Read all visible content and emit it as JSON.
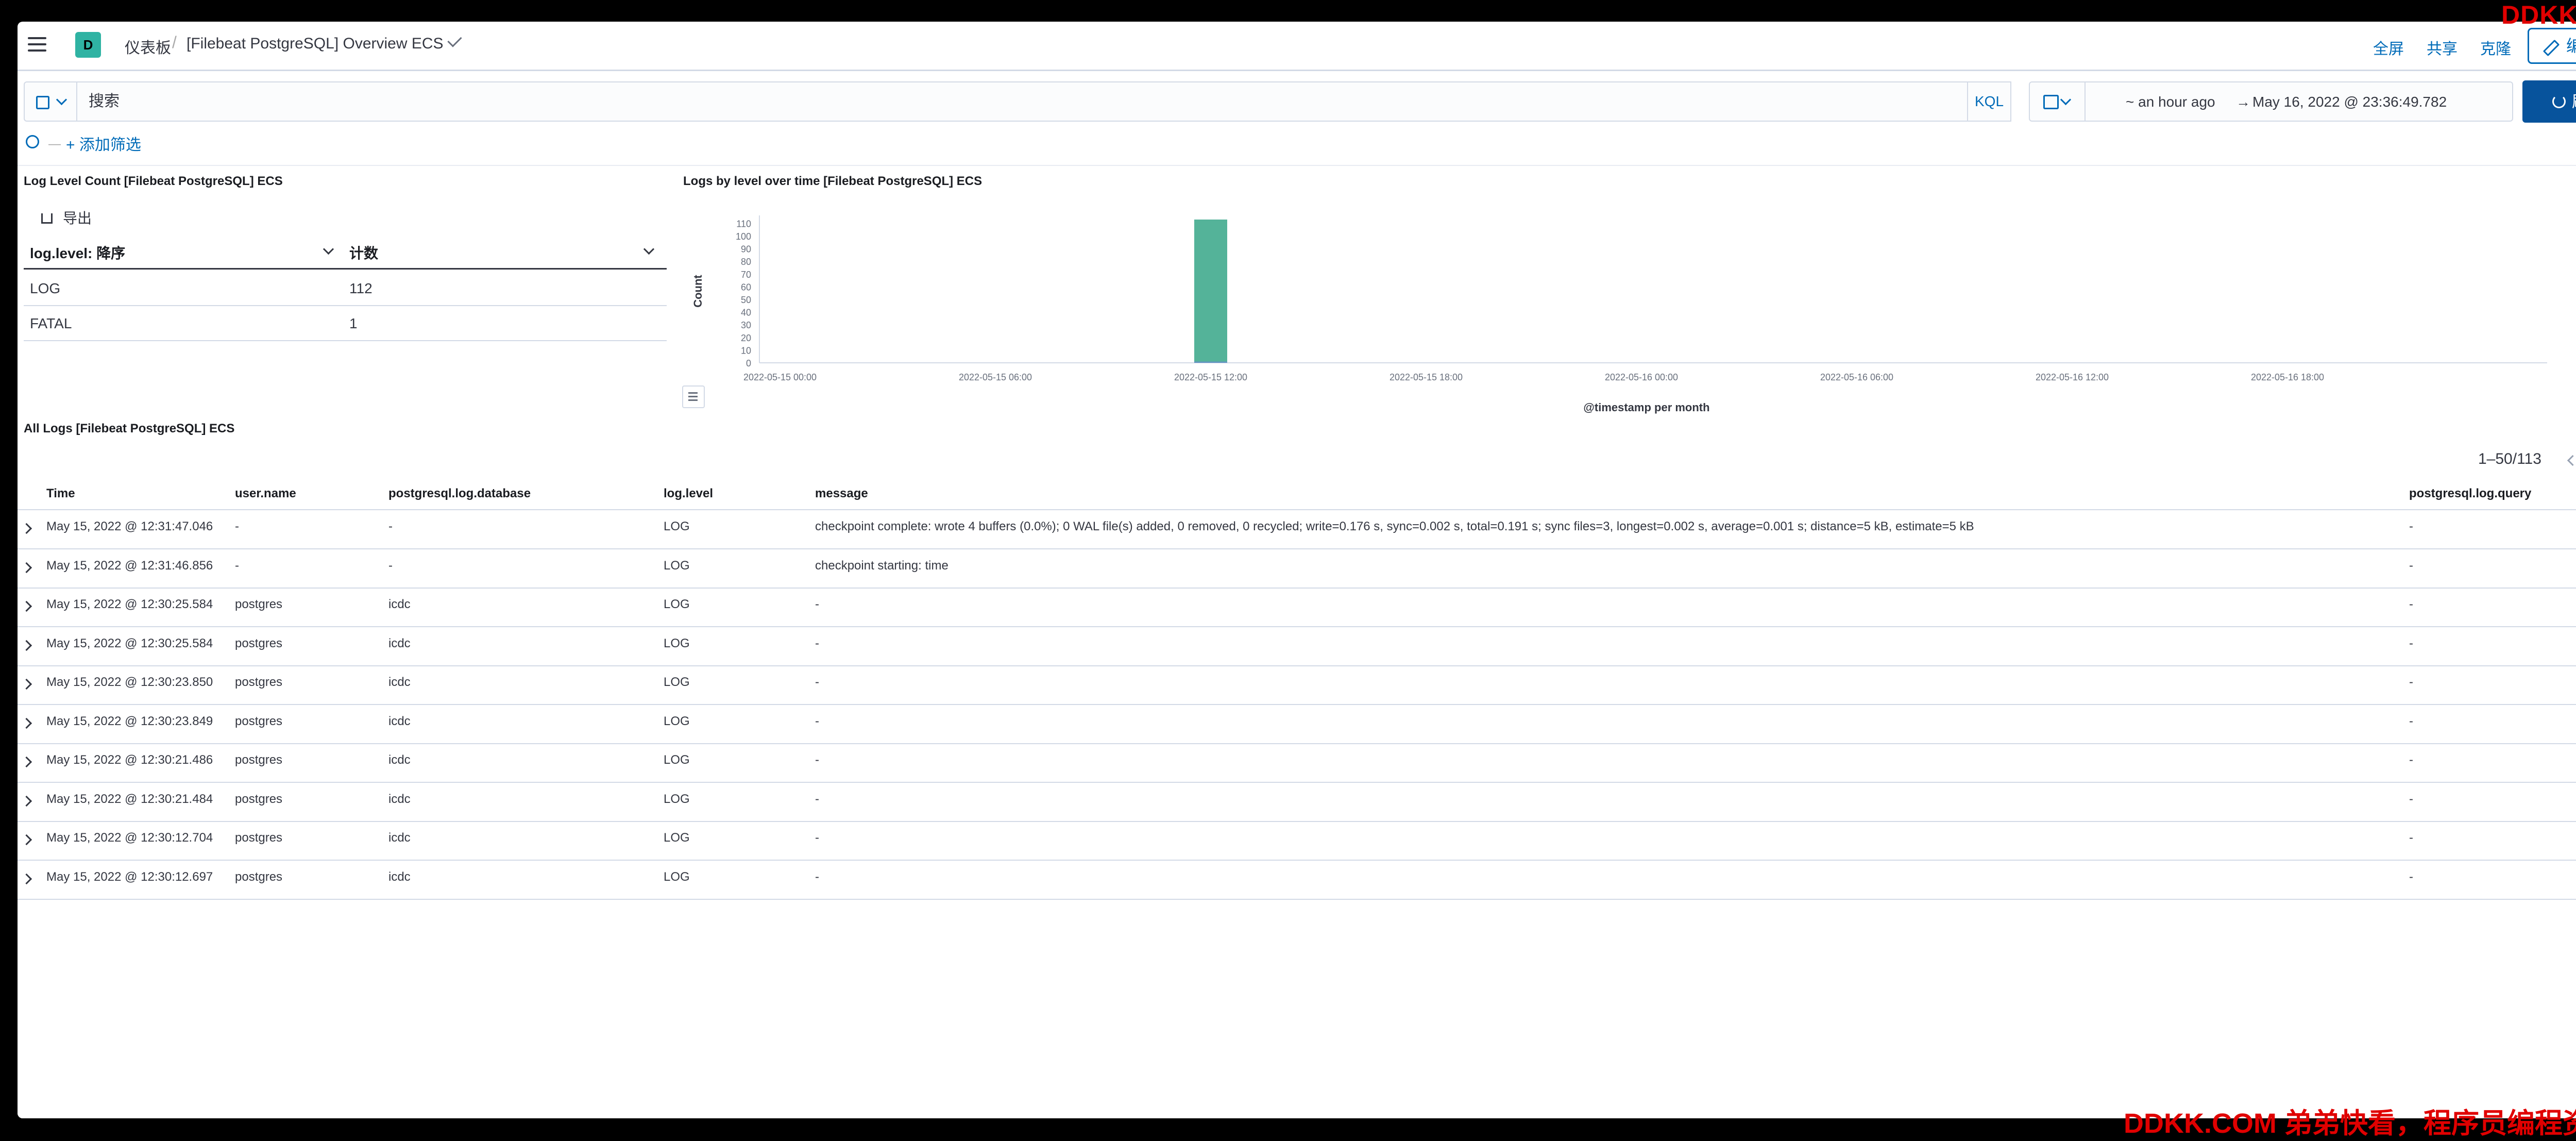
{
  "watermark": {
    "top": "DDKK.COM",
    "bottom": "DDKK.COM 弟弟快看，程序员编程资料站"
  },
  "header": {
    "space": "D",
    "crumb1": "仪表板",
    "crumb2": "[Filebeat PostgreSQL] Overview ECS",
    "fullscreen": "全屏",
    "share": "共享",
    "clone": "克隆",
    "edit": "编辑"
  },
  "query": {
    "placeholder": "搜索",
    "language": "KQL",
    "start": "~ an hour ago",
    "end": "May 16, 2022 @ 23:36:49.782",
    "refresh": "刷新",
    "add_filter": "+ 添加筛选"
  },
  "level_table": {
    "title": "Log Level Count [Filebeat PostgreSQL] ECS",
    "export": "导出",
    "col1": "log.level: 降序",
    "col2": "计数",
    "rows": [
      {
        "level": "LOG",
        "count": "112"
      },
      {
        "level": "FATAL",
        "count": "1"
      }
    ]
  },
  "chart_data": {
    "type": "bar",
    "title": "Logs by level over time [Filebeat PostgreSQL] ECS",
    "xlabel": "@timestamp per month",
    "ylabel": "Count",
    "x_ticks": [
      "2022-05-15 00:00",
      "2022-05-15 06:00",
      "2022-05-15 12:00",
      "2022-05-15 18:00",
      "2022-05-16 00:00",
      "2022-05-16 06:00",
      "2022-05-16 12:00",
      "2022-05-16 18:00"
    ],
    "y_ticks": [
      0,
      10,
      20,
      30,
      40,
      50,
      60,
      70,
      80,
      90,
      100,
      110
    ],
    "ylim": [
      0,
      113
    ],
    "series": [
      {
        "name": "FATAL",
        "color": "#6092c0",
        "points": [
          {
            "x": "2022-05-15 12:00",
            "y": 1
          }
        ]
      },
      {
        "name": "LOG",
        "color": "#54b399",
        "points": [
          {
            "x": "2022-05-15 12:00",
            "y": 112
          }
        ]
      }
    ],
    "legend_position": "right"
  },
  "logs": {
    "title": "All Logs [Filebeat PostgreSQL] ECS",
    "pager": "1–50/113",
    "columns": [
      "Time",
      "user.name",
      "postgresql.log.database",
      "log.level",
      "message",
      "postgresql.log.query"
    ],
    "rows": [
      [
        "May 15, 2022 @ 12:31:47.046",
        "-",
        "-",
        "LOG",
        "checkpoint complete: wrote 4 buffers (0.0%); 0 WAL file(s) added, 0 removed, 0 recycled; write=0.176 s, sync=0.002 s, total=0.191 s; sync files=3, longest=0.002 s, average=0.001 s; distance=5 kB, estimate=5 kB",
        "-"
      ],
      [
        "May 15, 2022 @ 12:31:46.856",
        "-",
        "-",
        "LOG",
        "checkpoint starting: time",
        "-"
      ],
      [
        "May 15, 2022 @ 12:30:25.584",
        "postgres",
        "icdc",
        "LOG",
        "-",
        "-"
      ],
      [
        "May 15, 2022 @ 12:30:25.584",
        "postgres",
        "icdc",
        "LOG",
        "-",
        "-"
      ],
      [
        "May 15, 2022 @ 12:30:23.850",
        "postgres",
        "icdc",
        "LOG",
        "-",
        "-"
      ],
      [
        "May 15, 2022 @ 12:30:23.849",
        "postgres",
        "icdc",
        "LOG",
        "-",
        "-"
      ],
      [
        "May 15, 2022 @ 12:30:21.486",
        "postgres",
        "icdc",
        "LOG",
        "-",
        "-"
      ],
      [
        "May 15, 2022 @ 12:30:21.484",
        "postgres",
        "icdc",
        "LOG",
        "-",
        "-"
      ],
      [
        "May 15, 2022 @ 12:30:12.704",
        "postgres",
        "icdc",
        "LOG",
        "-",
        "-"
      ],
      [
        "May 15, 2022 @ 12:30:12.697",
        "postgres",
        "icdc",
        "LOG",
        "-",
        "-"
      ]
    ]
  }
}
